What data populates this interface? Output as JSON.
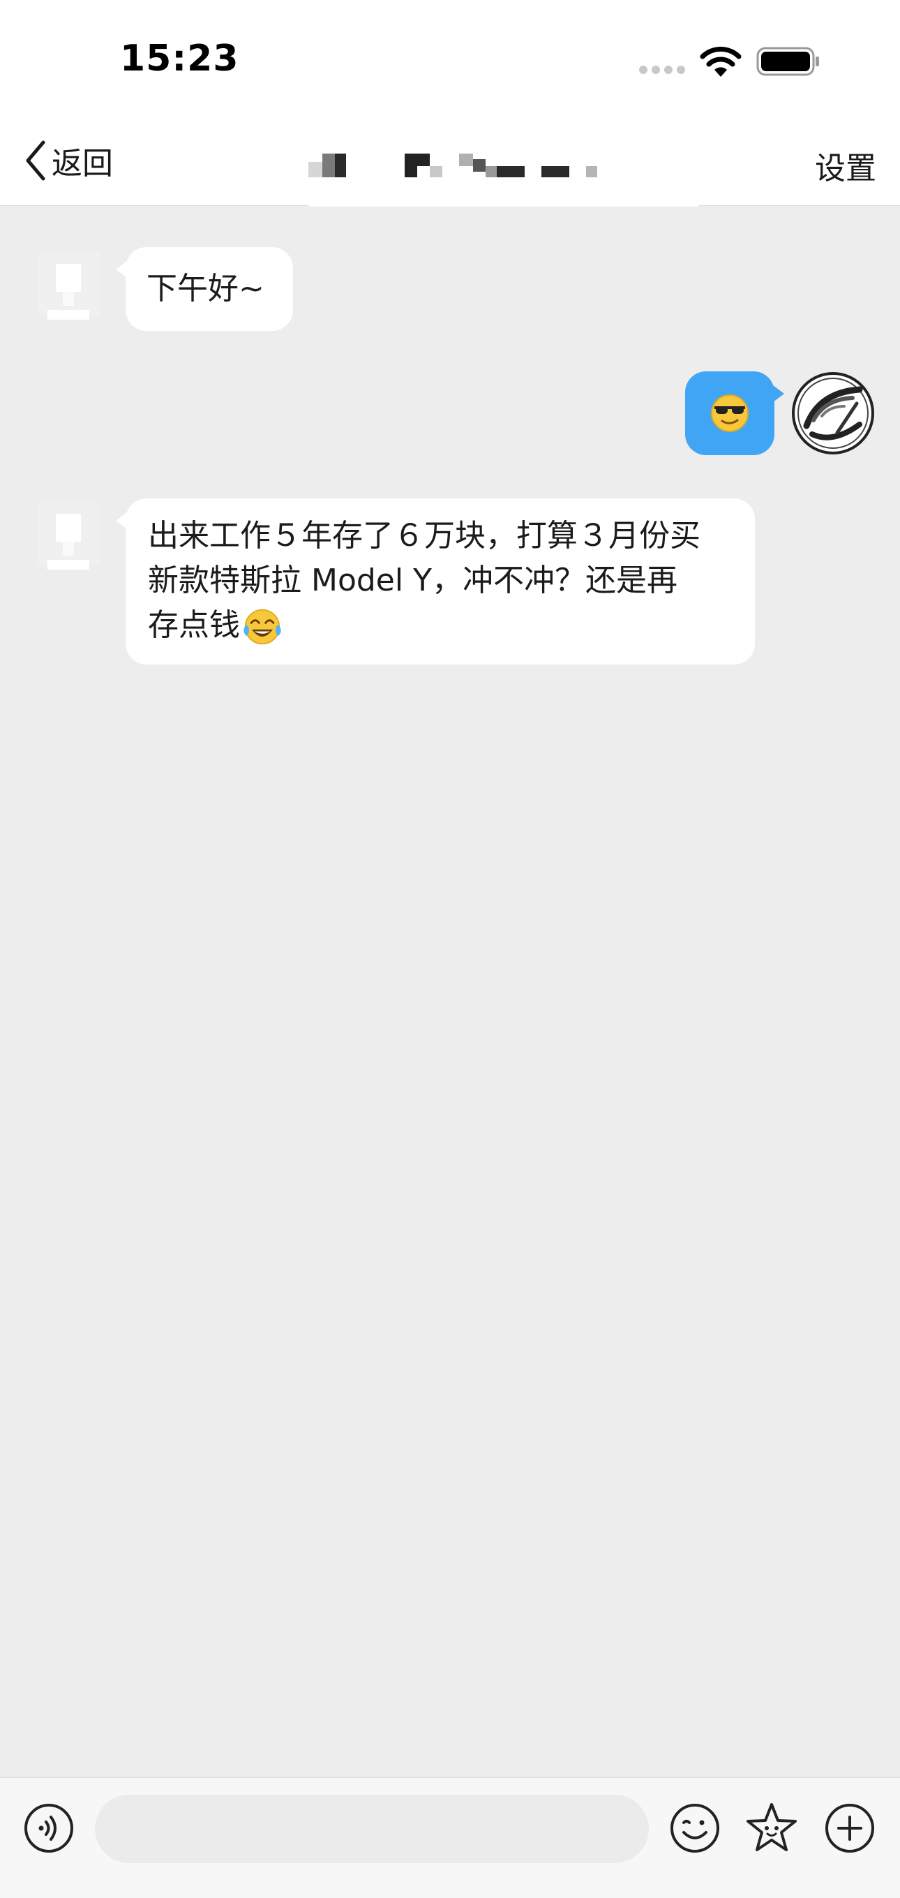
{
  "status_bar": {
    "time": "15:23",
    "signal_icon": "signal-dots-icon",
    "wifi_icon": "wifi-icon",
    "battery_icon": "battery-icon"
  },
  "nav": {
    "back_label": "返回",
    "settings_label": "设置",
    "title_obscured": true
  },
  "messages": [
    {
      "side": "incoming",
      "text": "下午好~"
    },
    {
      "side": "outgoing",
      "emoji": "sunglasses-emoji"
    },
    {
      "side": "incoming",
      "lines": [
        "出来工作５年存了６万块，打算３月份买",
        "新款特斯拉 Model Y，冲不冲？还是再",
        "存点钱"
      ],
      "trailing_emoji": "tears-of-joy-emoji"
    }
  ],
  "input_bar": {
    "placeholder": "",
    "voice_icon": "voice-icon",
    "emoji_icon": "emoji-icon",
    "sticker_icon": "star-sticker-icon",
    "plus_icon": "plus-icon"
  },
  "colors": {
    "background": "#ededed",
    "outgoing_bubble": "#41a5f5",
    "incoming_bubble": "#ffffff"
  }
}
